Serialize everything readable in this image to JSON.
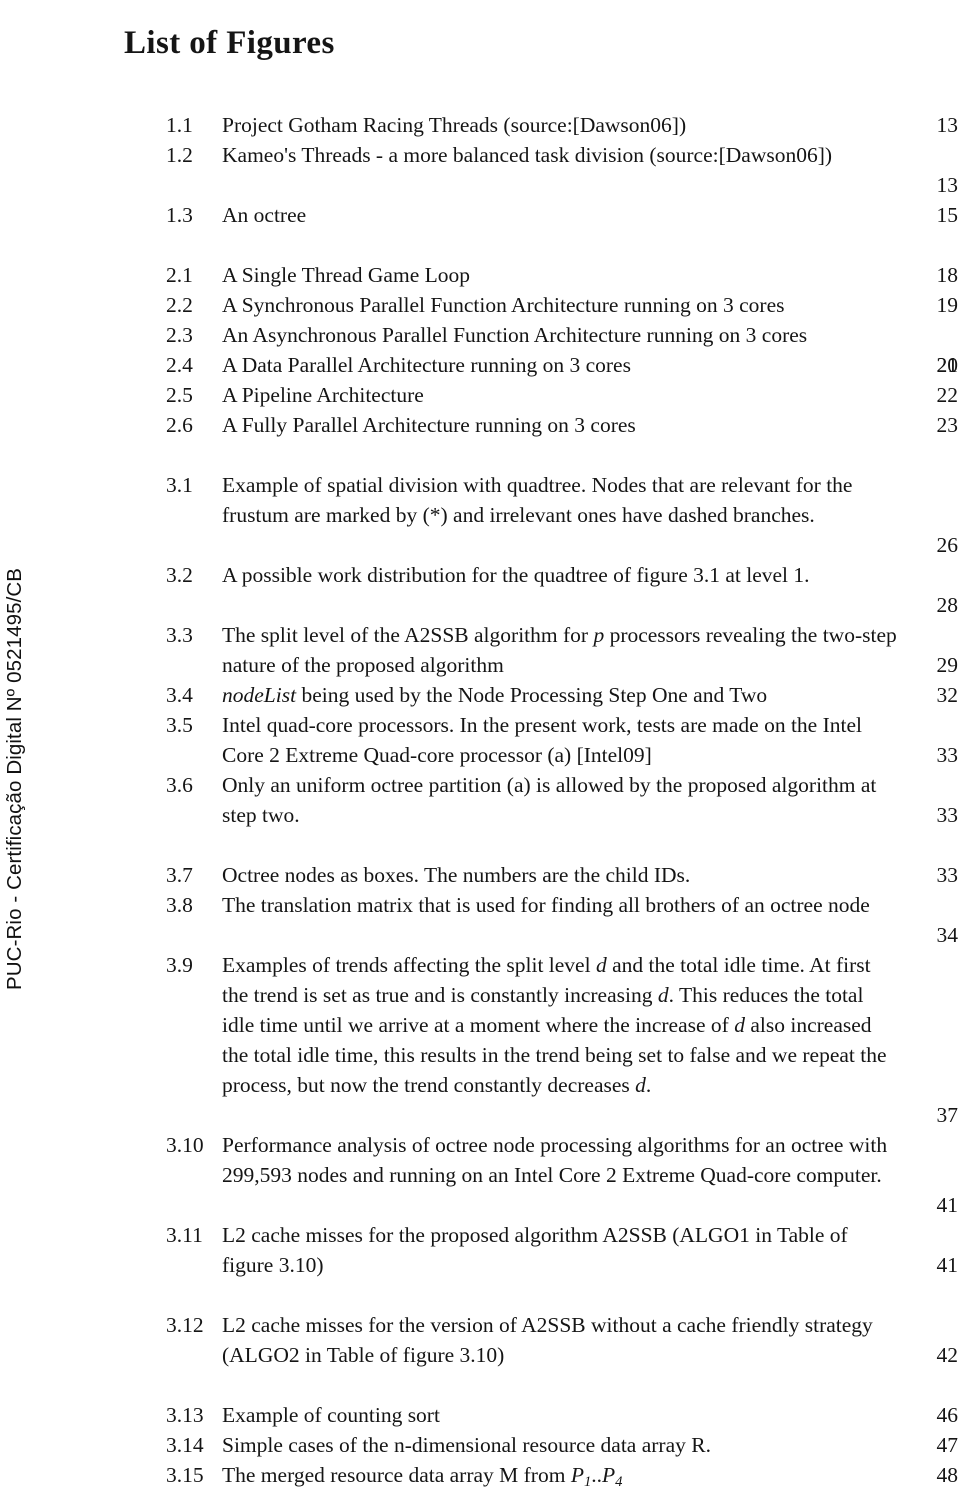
{
  "document": {
    "title": "List of Figures",
    "watermark": "PUC-Rio - Certificação Digital Nº 0521495/CB"
  },
  "groups": [
    {
      "chapter": "1",
      "entries": [
        {
          "num": "1.1",
          "caption": "Project Gotham Racing Threads (source:[Dawson06])",
          "page": "13",
          "lines": 1,
          "justify": false
        },
        {
          "num": "1.2",
          "caption": "Kameo's Threads - a more balanced task division (source:[Dawson06])",
          "page": "13",
          "lines": 2,
          "justify": true
        },
        {
          "num": "1.3",
          "caption": "An octree",
          "page": "15",
          "lines": 1,
          "justify": false
        }
      ]
    },
    {
      "chapter": "2",
      "entries": [
        {
          "num": "2.1",
          "caption": "A Single Thread Game Loop",
          "page": "18",
          "lines": 1,
          "justify": false
        },
        {
          "num": "2.2",
          "caption": "A Synchronous Parallel Function Architecture running on 3 cores",
          "page": "19",
          "lines": 1,
          "justify": false
        },
        {
          "num": "2.3",
          "caption": "An Asynchronous Parallel Function Architecture running on 3 cores",
          "page": "20",
          "lines": 2,
          "justify": false
        },
        {
          "num": "2.4",
          "caption": "A Data Parallel Architecture running on 3 cores",
          "page": "21",
          "lines": 1,
          "justify": false
        },
        {
          "num": "2.5",
          "caption": "A Pipeline Architecture",
          "page": "22",
          "lines": 1,
          "justify": false
        },
        {
          "num": "2.6",
          "caption": "A Fully Parallel Architecture running on 3 cores",
          "page": "23",
          "lines": 1,
          "justify": false
        }
      ]
    },
    {
      "chapter": "3",
      "entries": [
        {
          "num": "3.1",
          "caption": "Example of spatial division with quadtree. Nodes that are relevant for the frustum are marked by (*) and irrelevant ones have dashed branches.",
          "page": "26",
          "lines": 3,
          "justify": true
        },
        {
          "num": "3.2",
          "caption": "A possible work distribution for the quadtree of figure 3.1 at level 1.",
          "page": "28",
          "lines": 2,
          "justify": true
        },
        {
          "num": "3.3",
          "caption": "The split level of the A2SSB algorithm for p processors revealing the two-step nature of the proposed algorithm",
          "page": "29",
          "lines": 2,
          "justify": false,
          "italics": [
            "p"
          ]
        },
        {
          "num": "3.4",
          "caption": "nodeList being used by the Node Processing Step One and Two",
          "page": "32",
          "lines": 1,
          "justify": false,
          "italics": [
            "nodeList"
          ]
        },
        {
          "num": "3.5",
          "caption": "Intel quad-core processors. In the present work, tests are made on the Intel Core 2 Extreme Quad-core processor (a) [Intel09]",
          "page": "33",
          "lines": 2,
          "justify": false
        },
        {
          "num": "3.6",
          "caption": "Only an uniform octree partition (a) is allowed by the proposed algorithm at step two.",
          "page": "33",
          "lines": 2,
          "justify": true
        },
        {
          "num": "3.7",
          "caption": "Octree nodes as boxes. The numbers are the child IDs.",
          "page": "33",
          "lines": 1,
          "justify": false
        },
        {
          "num": "3.8",
          "caption": "The translation matrix that is used for finding all brothers of an octree node",
          "page": "34",
          "lines": 2,
          "justify": true
        },
        {
          "num": "3.9",
          "caption": "Examples of trends affecting the split level d and the total idle time. At first the trend is set as true and is constantly increasing d. This reduces the total idle time until we arrive at a moment where the increase of d also increased the total idle time, this results in the trend being set to false and we repeat the process, but now the trend constantly decreases d.",
          "page": "37",
          "lines": 6,
          "justify": true,
          "italics": [
            "d"
          ]
        },
        {
          "num": "3.10",
          "caption": "Performance analysis of octree node processing algorithms for an octree with 299,593 nodes and running on an Intel Core 2 Extreme Quad-core computer.",
          "page": "41",
          "lines": 3,
          "justify": true
        },
        {
          "num": "3.11",
          "caption": "L2 cache misses for the proposed algorithm A2SSB (ALGO1 in Table of figure 3.10)",
          "page": "41",
          "lines": 2,
          "justify": true
        },
        {
          "num": "3.12",
          "caption": "L2 cache misses for the version of A2SSB without a cache friendly strategy (ALGO2 in Table of figure 3.10)",
          "page": "42",
          "lines": 2,
          "justify": true
        },
        {
          "num": "3.13",
          "caption": "Example of counting sort",
          "page": "46",
          "lines": 1,
          "justify": false
        },
        {
          "num": "3.14",
          "caption": "Simple cases of the n-dimensional resource data array R.",
          "page": "47",
          "lines": 1,
          "justify": false
        },
        {
          "num": "3.15",
          "caption": "The merged resource data array M from P1..P4",
          "page": "48",
          "lines": 1,
          "justify": false,
          "math": "P_1..P_4"
        }
      ]
    }
  ]
}
